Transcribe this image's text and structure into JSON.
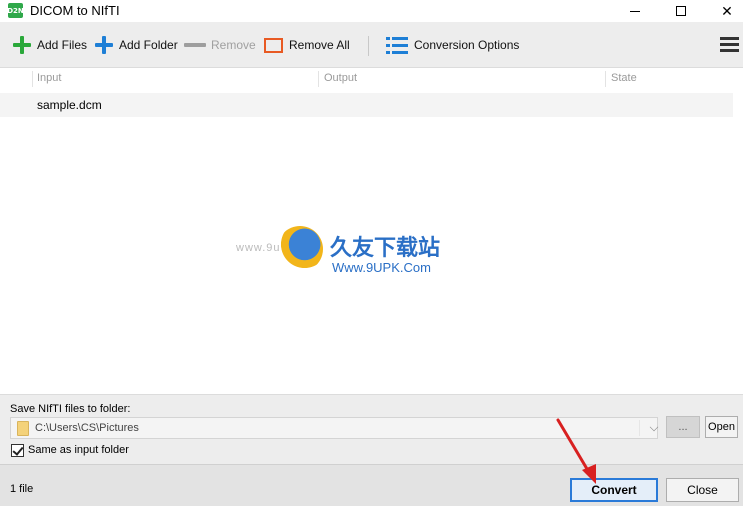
{
  "window": {
    "title": "DICOM to NIfTI",
    "app_icon_text": "D2N"
  },
  "toolbar": {
    "add_files": "Add Files",
    "add_folder": "Add Folder",
    "remove": "Remove",
    "remove_all": "Remove All",
    "conversion_options": "Conversion Options"
  },
  "list": {
    "columns": [
      "Input",
      "Output",
      "State"
    ],
    "rows": [
      {
        "input": "sample.dcm",
        "output": "",
        "state": ""
      }
    ]
  },
  "watermark": {
    "left_text": "www.9u",
    "chinese_text": "久友下载站",
    "url_text": "Www.9UPK.Com"
  },
  "save": {
    "label": "Save NIfTI files to folder:",
    "path": "C:\\Users\\CS\\Pictures",
    "browse_label": "...",
    "open_label": "Open",
    "same_as_input_label": "Same as input folder",
    "same_as_input_checked": true
  },
  "status": {
    "count_text": "1 file",
    "convert_label": "Convert",
    "close_label": "Close"
  },
  "colors": {
    "accent_blue": "#1e7fd6",
    "add_green": "#2aa83a",
    "remove_all_orange": "#e85a23",
    "annotation_red": "#d82020"
  }
}
